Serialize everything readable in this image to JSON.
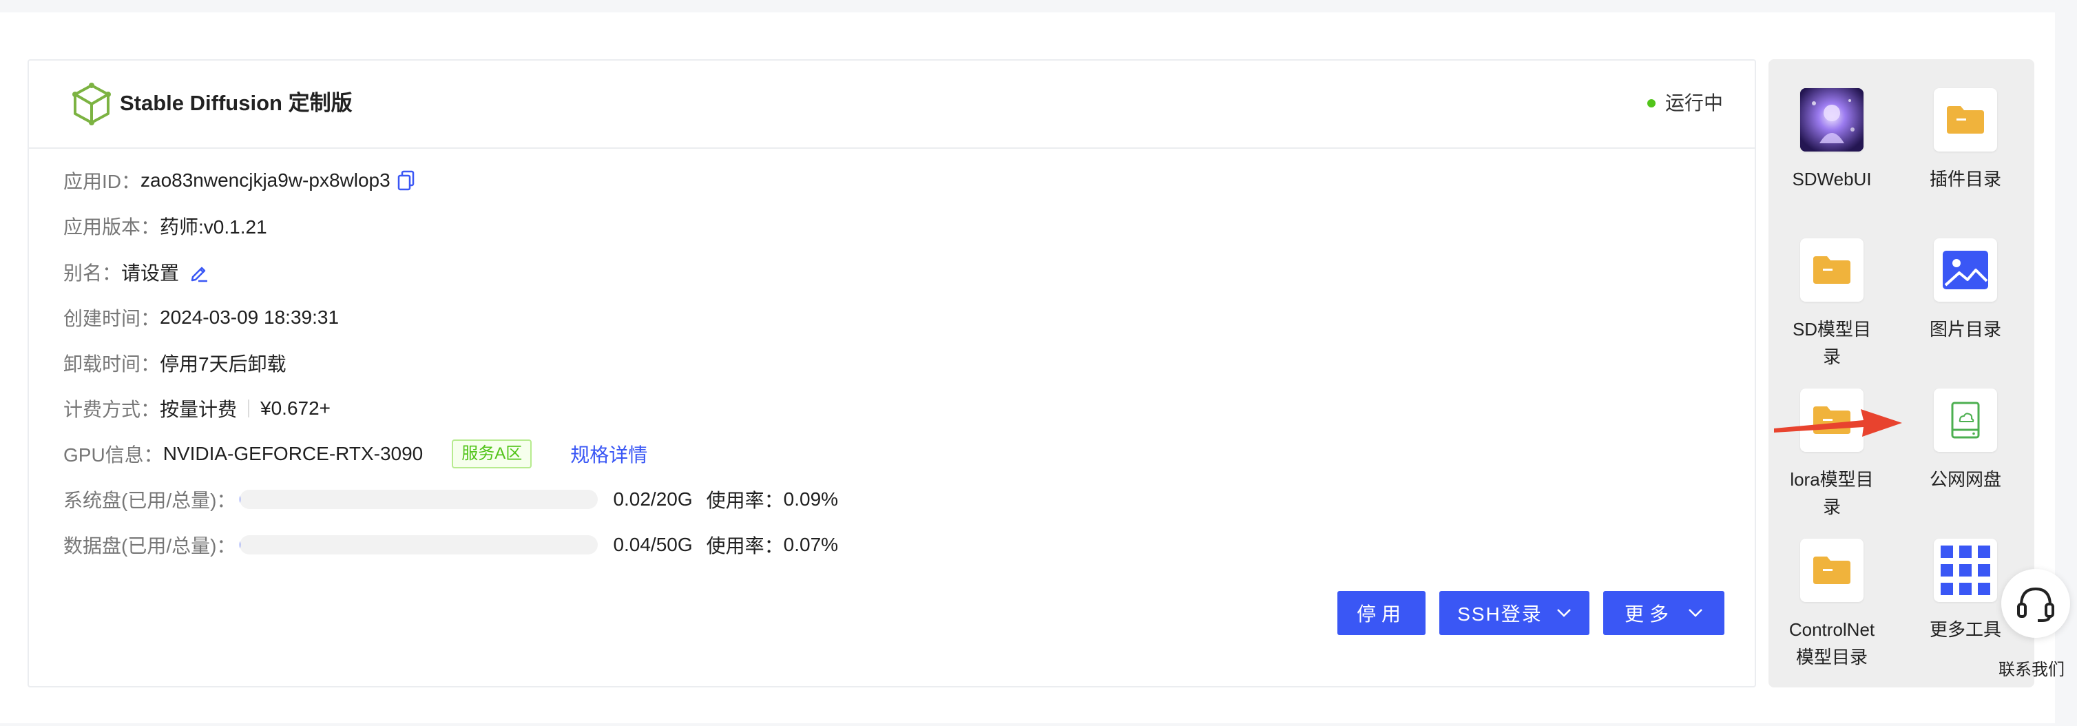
{
  "app": {
    "title": "Stable Diffusion 定制版",
    "status": "运行中"
  },
  "info": {
    "app_id": {
      "label": "应用ID：",
      "value": "zao83nwencjkja9w-px8wlop3"
    },
    "version": {
      "label": "应用版本：",
      "value": "药师:v0.1.21"
    },
    "alias": {
      "label": "别名：",
      "value": "请设置"
    },
    "created": {
      "label": "创建时间：",
      "value": "2024-03-09 18:39:31"
    },
    "uninstall": {
      "label": "卸载时间：",
      "value": "停用7天后卸载"
    },
    "billing": {
      "label": "计费方式：",
      "value": "按量计费",
      "price": "¥0.672+"
    },
    "gpu": {
      "label": "GPU信息：",
      "value": "NVIDIA-GEFORCE-RTX-3090",
      "zone": "服务A区",
      "spec_link": "规格详情"
    },
    "system_disk": {
      "label": "系统盘(已用/总量)：",
      "value": "0.02/20G",
      "usage_label": "使用率：",
      "usage": "0.09%",
      "fill_fraction": 0.0009
    },
    "data_disk": {
      "label": "数据盘(已用/总量)：",
      "value": "0.04/50G",
      "usage_label": "使用率：",
      "usage": "0.07%",
      "fill_fraction": 0.0007
    }
  },
  "buttons": {
    "stop": "停用",
    "ssh": "SSH登录",
    "more": "更多"
  },
  "tools": [
    {
      "label": "SDWebUI",
      "icon": "sdwebui-thumbnail"
    },
    {
      "label": "插件目录",
      "icon": "folder-icon"
    },
    {
      "label": "SD模型目录",
      "icon": "folder-icon"
    },
    {
      "label": "图片目录",
      "icon": "image-icon"
    },
    {
      "label": "lora模型目录",
      "icon": "folder-icon"
    },
    {
      "label": "公网网盘",
      "icon": "cloud-drive-icon"
    },
    {
      "label": "ControlNet模型目录",
      "icon": "folder-icon"
    },
    {
      "label": "更多工具",
      "icon": "grid-icon"
    }
  ],
  "help": {
    "label": "联系我们"
  },
  "colors": {
    "primary": "#3a57f5",
    "folder": "#f0b33c",
    "success": "#52c41a",
    "arrow": "#e8432e"
  }
}
